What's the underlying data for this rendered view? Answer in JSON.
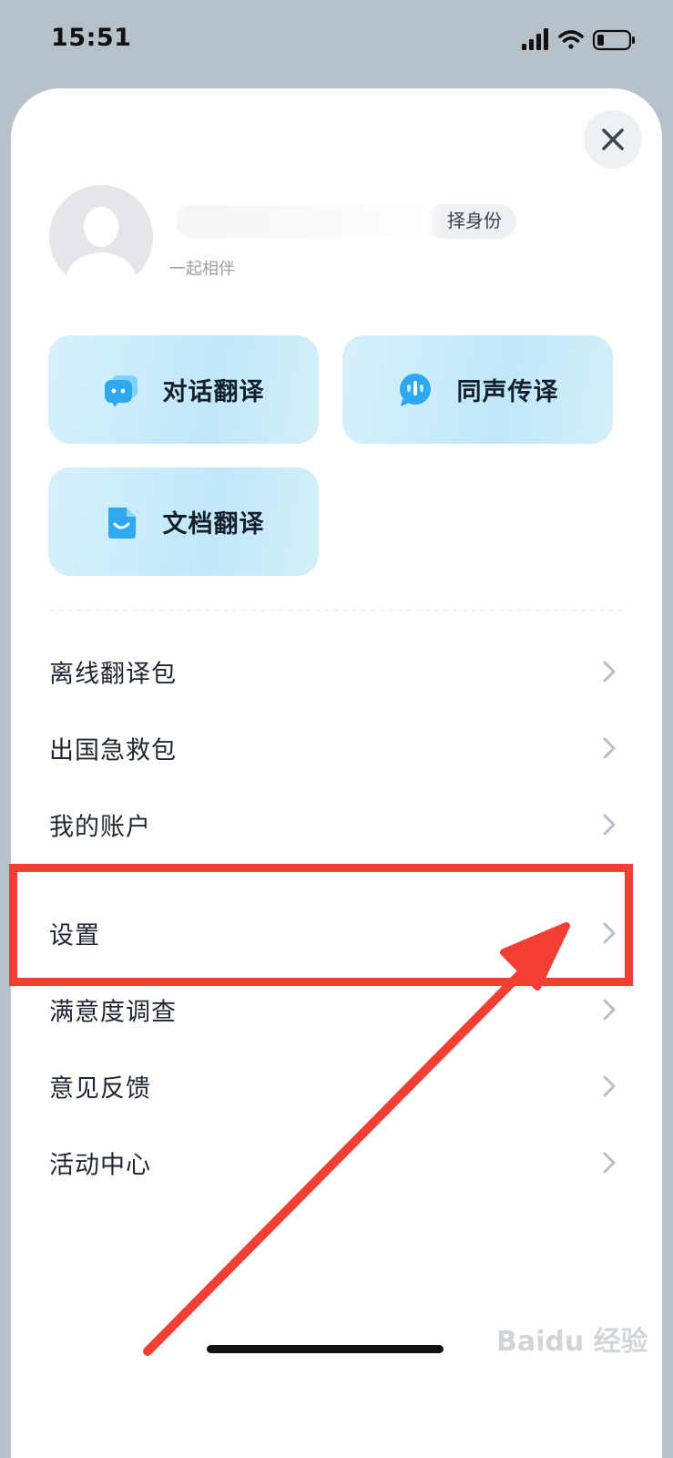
{
  "status_bar": {
    "time": "15:51",
    "icons": [
      "signal-icon",
      "wifi-icon",
      "battery-icon"
    ]
  },
  "sheet": {
    "close_icon": "close-icon",
    "profile": {
      "avatar": "avatar-placeholder",
      "identity_tag": "择身份",
      "subtitle": "一起相伴"
    },
    "features": [
      {
        "label": "对话翻译",
        "icon": "chat-bubble-icon"
      },
      {
        "label": "同声传译",
        "icon": "microphone-bubble-icon"
      },
      {
        "label": "文档翻译",
        "icon": "document-icon"
      }
    ],
    "menu": [
      {
        "label": "离线翻译包"
      },
      {
        "label": "出国急救包"
      },
      {
        "label": "我的账户"
      },
      {
        "label": "设置"
      },
      {
        "label": "满意度调查"
      },
      {
        "label": "意见反馈"
      },
      {
        "label": "活动中心"
      }
    ]
  },
  "watermark": "Baidu 经验",
  "annotation": {
    "color": "#f33e34",
    "target": "设置"
  },
  "colors": {
    "background": "#b6c1ca",
    "card_gradient": "#bfe8f9",
    "icon_blue": "#2ea8f0",
    "annotation_red": "#f33e34"
  }
}
